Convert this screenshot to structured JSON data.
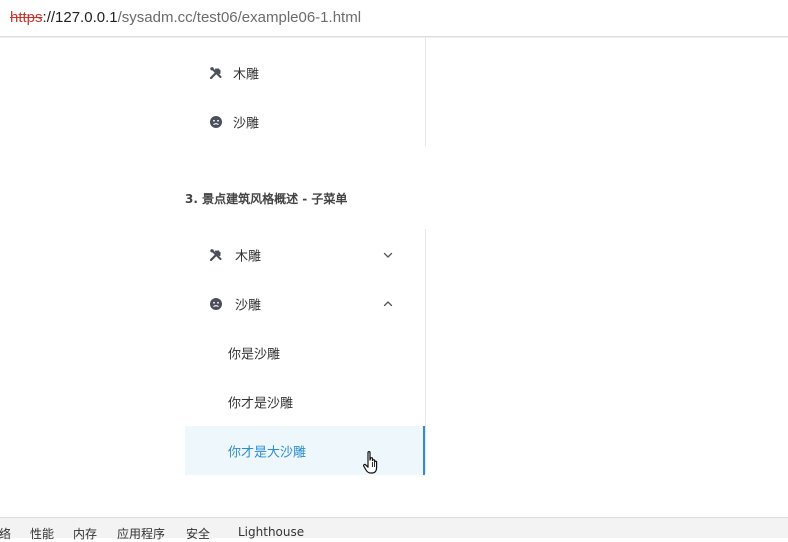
{
  "browser": {
    "url_scheme": "https",
    "url_host": "://127.0.0.1",
    "url_path": "/sysadm.cc/test06/example06-1.html"
  },
  "top_menu": {
    "items": [
      {
        "label": "木雕",
        "icon": "tools-icon"
      },
      {
        "label": "沙雕",
        "icon": "face-icon"
      }
    ]
  },
  "section": {
    "title": "3. 景点建筑风格概述 - 子菜单"
  },
  "sub_menu": {
    "items": [
      {
        "label": "木雕",
        "icon": "tools-icon",
        "expanded": false
      },
      {
        "label": "沙雕",
        "icon": "face-icon",
        "expanded": true
      }
    ],
    "children": [
      {
        "label": "你是沙雕"
      },
      {
        "label": "你才是沙雕"
      },
      {
        "label": "你才是大沙雕",
        "active": true
      }
    ]
  },
  "devtools": {
    "tabs": [
      "络",
      "性能",
      "内存",
      "应用程序",
      "安全",
      "Lighthouse"
    ]
  },
  "colors": {
    "accent": "#2e8ccf",
    "active_bg": "#eef7fb",
    "icon": "#4a4f5a"
  }
}
